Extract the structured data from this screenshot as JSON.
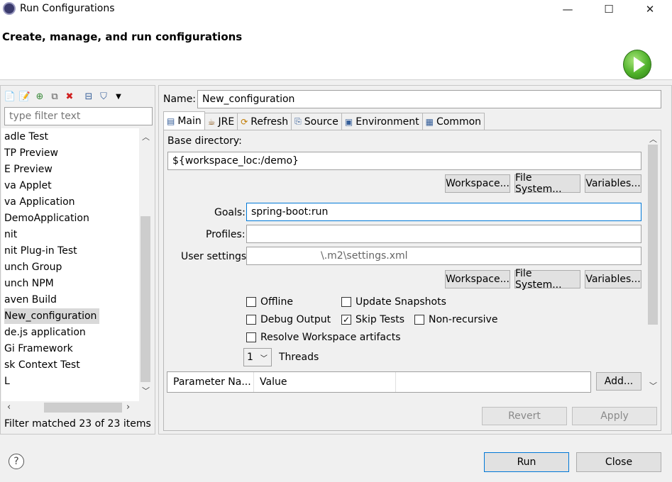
{
  "window": {
    "title": "Run Configurations",
    "minimize_glyph": "—",
    "maximize_glyph": "☐",
    "close_glyph": "✕"
  },
  "header": {
    "title": "Create, manage, and run configurations",
    "icon": "run-icon"
  },
  "left": {
    "filter_placeholder": "type filter text",
    "items": [
      "adle Test",
      "TP Preview",
      "E Preview",
      "va Applet",
      "va Application",
      " DemoApplication",
      "nit",
      "nit Plug-in Test",
      "unch Group",
      "unch NPM",
      "aven Build",
      "New_configuration",
      "de.js application",
      "Gi Framework",
      "sk Context Test",
      "L"
    ],
    "selected_index": 11,
    "status": "Filter matched 23 of 23 items"
  },
  "config": {
    "name_label": "Name:",
    "name_value": "New_configuration",
    "tabs": [
      {
        "label": "Main",
        "icon": "main-tab-icon",
        "glyph": "▤"
      },
      {
        "label": "JRE",
        "icon": "jre-tab-icon",
        "glyph": "☕"
      },
      {
        "label": "Refresh",
        "icon": "refresh-tab-icon",
        "glyph": "⟳"
      },
      {
        "label": "Source",
        "icon": "source-tab-icon",
        "glyph": "⎘"
      },
      {
        "label": "Environment",
        "icon": "environment-tab-icon",
        "glyph": "▣"
      },
      {
        "label": "Common",
        "icon": "common-tab-icon",
        "glyph": "▦"
      }
    ],
    "base_dir_label": "Base directory:",
    "base_dir_value": "${workspace_loc:/demo}",
    "workspace_btn": "Workspace...",
    "filesystem_btn": "File System...",
    "variables_btn": "Variables...",
    "goals_label": "Goals:",
    "goals_value": "spring-boot:run",
    "profiles_label": "Profiles:",
    "profiles_value": "",
    "user_settings_label": "User settings:",
    "user_settings_value": "\\.m2\\settings.xml",
    "checkboxes": {
      "offline": {
        "label": "Offline",
        "checked": false
      },
      "update_snapshots": {
        "label": "Update Snapshots",
        "checked": false
      },
      "debug_output": {
        "label": "Debug Output",
        "checked": false
      },
      "skip_tests": {
        "label": "Skip Tests",
        "checked": true
      },
      "non_recursive": {
        "label": "Non-recursive",
        "checked": false
      },
      "resolve_workspace": {
        "label": "Resolve Workspace artifacts",
        "checked": false
      }
    },
    "threads_value": "1",
    "threads_label": "Threads",
    "param_headers": [
      "Parameter Na...",
      "Value"
    ],
    "add_btn": "Add...",
    "revert_btn": "Revert",
    "apply_btn": "Apply"
  },
  "footer": {
    "run_btn": "Run",
    "close_btn": "Close",
    "help_glyph": "?"
  },
  "colors": {
    "accent": "#0078d7",
    "run_green": "#4fb12a"
  }
}
